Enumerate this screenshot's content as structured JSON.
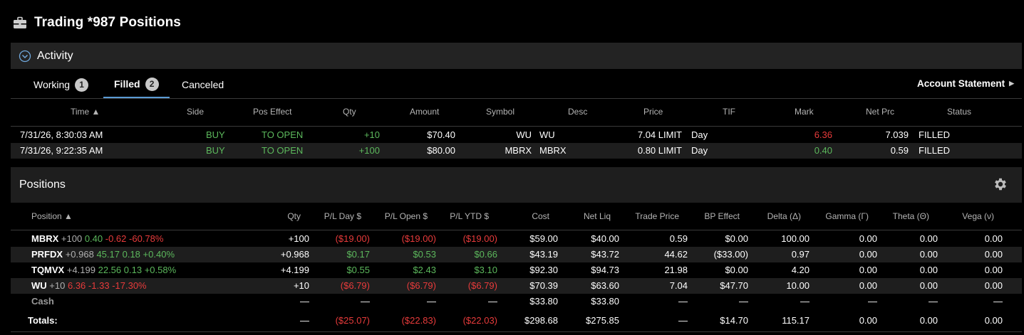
{
  "header": {
    "title": "Trading *987 Positions"
  },
  "activity": {
    "label": "Activity"
  },
  "tabs": [
    {
      "label": "Working",
      "badge": "1"
    },
    {
      "label": "Filled",
      "badge": "2"
    },
    {
      "label": "Canceled"
    }
  ],
  "account_statement": "Account Statement",
  "orders": {
    "columns": [
      "Time ▲",
      "Side",
      "Pos Effect",
      "Qty",
      "Amount",
      "Symbol",
      "Desc",
      "Price",
      "TIF",
      "Mark",
      "Net Prc",
      "Status"
    ],
    "rows": [
      {
        "time": "7/31/26, 8:30:03 AM",
        "side": "BUY",
        "pos_effect": "TO OPEN",
        "qty": "+10",
        "amount": "$70.40",
        "symbol": "WU",
        "desc": "WU",
        "price": "7.04 LIMIT",
        "tif": "Day",
        "mark": "6.36",
        "net_prc": "7.039",
        "status": "FILLED"
      },
      {
        "time": "7/31/26, 9:22:35 AM",
        "side": "BUY",
        "pos_effect": "TO OPEN",
        "qty": "+100",
        "amount": "$80.00",
        "symbol": "MBRX",
        "desc": "MBRX",
        "price": "0.80 LIMIT",
        "tif": "Day",
        "mark": "0.40",
        "net_prc": "0.59",
        "status": "FILLED"
      }
    ]
  },
  "positions": {
    "title": "Positions",
    "columns": [
      "Position ▲",
      "Qty",
      "P/L Day $",
      "P/L Open $",
      "P/L YTD $",
      "Cost",
      "Net Liq",
      "Trade Price",
      "BP Effect",
      "Delta (Δ)",
      "Gamma (Γ)",
      "Theta (Θ)",
      "Vega (ν)"
    ],
    "rows": [
      {
        "sym": "MBRX",
        "q": "+100",
        "last": "0.40",
        "chg": "-0.62",
        "pct": "-60.78%",
        "qty": "+100",
        "pl_day": "($19.00)",
        "pl_open": "($19.00)",
        "pl_ytd": "($19.00)",
        "cost": "$59.00",
        "net_liq": "$40.00",
        "trade_price": "0.59",
        "bp_effect": "$0.00",
        "delta": "100.00",
        "gamma": "0.00",
        "theta": "0.00",
        "vega": "0.00"
      },
      {
        "sym": "PRFDX",
        "q": "+0.968",
        "last": "45.17",
        "chg": "0.18",
        "pct": "+0.40%",
        "qty": "+0.968",
        "pl_day": "$0.17",
        "pl_open": "$0.53",
        "pl_ytd": "$0.66",
        "cost": "$43.19",
        "net_liq": "$43.72",
        "trade_price": "44.62",
        "bp_effect": "($33.00)",
        "delta": "0.97",
        "gamma": "0.00",
        "theta": "0.00",
        "vega": "0.00"
      },
      {
        "sym": "TQMVX",
        "q": "+4.199",
        "last": "22.56",
        "chg": "0.13",
        "pct": "+0.58%",
        "qty": "+4.199",
        "pl_day": "$0.55",
        "pl_open": "$2.43",
        "pl_ytd": "$3.10",
        "cost": "$92.30",
        "net_liq": "$94.73",
        "trade_price": "21.98",
        "bp_effect": "$0.00",
        "delta": "4.20",
        "gamma": "0.00",
        "theta": "0.00",
        "vega": "0.00"
      },
      {
        "sym": "WU",
        "q": "+10",
        "last": "6.36",
        "chg": "-1.33",
        "pct": "-17.30%",
        "qty": "+10",
        "pl_day": "($6.79)",
        "pl_open": "($6.79)",
        "pl_ytd": "($6.79)",
        "cost": "$70.39",
        "net_liq": "$63.60",
        "trade_price": "7.04",
        "bp_effect": "$47.70",
        "delta": "10.00",
        "gamma": "0.00",
        "theta": "0.00",
        "vega": "0.00"
      }
    ],
    "cash": {
      "label": "Cash",
      "qty": "—",
      "pl_day": "—",
      "pl_open": "—",
      "pl_ytd": "—",
      "cost": "$33.80",
      "net_liq": "$33.80",
      "trade_price": "—",
      "bp_effect": "—",
      "delta": "—",
      "gamma": "—",
      "theta": "—",
      "vega": "—"
    },
    "totals": {
      "label": "Totals:",
      "qty": "—",
      "pl_day": "($25.07)",
      "pl_open": "($22.83)",
      "pl_ytd": "($22.03)",
      "cost": "$298.68",
      "net_liq": "$275.85",
      "trade_price": "—",
      "bp_effect": "$14.70",
      "delta": "115.17",
      "gamma": "0.00",
      "theta": "0.00",
      "vega": "0.00"
    }
  },
  "icons": {
    "title": "briefcase-icon",
    "activity": "chevron-down-circle-icon",
    "account": "caret-right-icon",
    "settings": "gear-icon"
  }
}
